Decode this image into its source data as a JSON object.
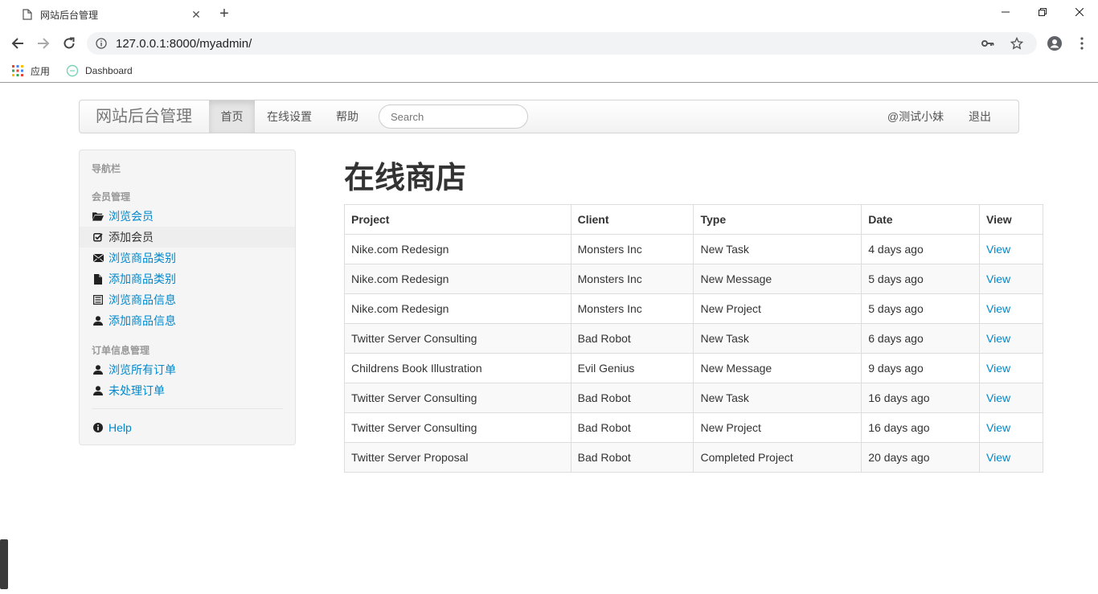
{
  "browser": {
    "tab_title": "网站后台管理",
    "url": "127.0.0.1:8000/myadmin/",
    "bookmarks": [
      {
        "label": "应用",
        "icon": "apps-grid-icon"
      },
      {
        "label": "Dashboard",
        "icon": "dashboard-favicon-icon"
      }
    ]
  },
  "navbar": {
    "brand": "网站后台管理",
    "items": [
      {
        "label": "首页",
        "active": true
      },
      {
        "label": "在线设置"
      },
      {
        "label": "帮助"
      }
    ],
    "search_placeholder": "Search",
    "user": "@测试小妹",
    "logout": "退出"
  },
  "sidebar": {
    "header": "导航栏",
    "groups": [
      {
        "title": "会员管理",
        "items": [
          {
            "label": "浏览会员",
            "icon": "folder-open-icon"
          },
          {
            "label": "添加会员",
            "icon": "check-icon",
            "active": true
          },
          {
            "label": "浏览商品类别",
            "icon": "envelope-icon"
          },
          {
            "label": "添加商品类别",
            "icon": "file-icon"
          },
          {
            "label": "浏览商品信息",
            "icon": "list-alt-icon"
          },
          {
            "label": "添加商品信息",
            "icon": "user-icon"
          }
        ]
      },
      {
        "title": "订单信息管理",
        "items": [
          {
            "label": "浏览所有订单",
            "icon": "user-icon"
          },
          {
            "label": "未处理订单",
            "icon": "user-icon"
          }
        ]
      }
    ],
    "help": {
      "label": "Help",
      "icon": "info-sign-icon"
    }
  },
  "main": {
    "title": "在线商店",
    "table": {
      "headers": [
        "Project",
        "Client",
        "Type",
        "Date",
        "View"
      ],
      "rows": [
        [
          "Nike.com Redesign",
          "Monsters Inc",
          "New Task",
          "4 days ago",
          "View"
        ],
        [
          "Nike.com Redesign",
          "Monsters Inc",
          "New Message",
          "5 days ago",
          "View"
        ],
        [
          "Nike.com Redesign",
          "Monsters Inc",
          "New Project",
          "5 days ago",
          "View"
        ],
        [
          "Twitter Server Consulting",
          "Bad Robot",
          "New Task",
          "6 days ago",
          "View"
        ],
        [
          "Childrens Book Illustration",
          "Evil Genius",
          "New Message",
          "9 days ago",
          "View"
        ],
        [
          "Twitter Server Consulting",
          "Bad Robot",
          "New Task",
          "16 days ago",
          "View"
        ],
        [
          "Twitter Server Consulting",
          "Bad Robot",
          "New Project",
          "16 days ago",
          "View"
        ],
        [
          "Twitter Server Proposal",
          "Bad Robot",
          "Completed Project",
          "20 days ago",
          "View"
        ]
      ]
    }
  },
  "colors": {
    "link": "#0088cc",
    "text": "#333333",
    "muted": "#999999"
  }
}
